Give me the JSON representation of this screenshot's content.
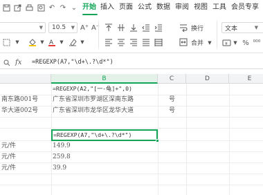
{
  "menu": {
    "tabs": [
      "开始",
      "插入",
      "页面",
      "公式",
      "数据",
      "审阅",
      "视图",
      "工具",
      "会员专享"
    ],
    "active": "开始"
  },
  "ribbon": {
    "font_size": "10.5",
    "font_grow": "A⁺",
    "font_shrink": "A⁻",
    "wrap_label": "换行",
    "merge_label": "合并",
    "number_format": "文本"
  },
  "formula_bar": {
    "fx": "fx",
    "formula": "=REGEXP(A7,\"\\d+\\.?\\d*\")"
  },
  "columns": [
    "B",
    "C",
    "D",
    "E"
  ],
  "selected_column": "B",
  "cells": {
    "b1": "=REGEXP(A2,\"[一-龟]+\",0)",
    "a2": "南东路001号",
    "b2": "广东省深圳市罗湖区深南东路",
    "c2": "号",
    "a3": "华大道002号",
    "b3": "广东省深圳市龙华区龙华大道",
    "c3": "号",
    "b6": "=REGEXP(A7,\"\\d+\\.?\\d*\")",
    "a7": "元/件",
    "b7": "149.9",
    "a8": "元/件",
    "b8": "259.8",
    "a9": "元/件",
    "b9": "39.9"
  },
  "colors": {
    "accent": "#12a557",
    "header_bg": "#f2f3f5",
    "grid_line": "#ececec"
  }
}
